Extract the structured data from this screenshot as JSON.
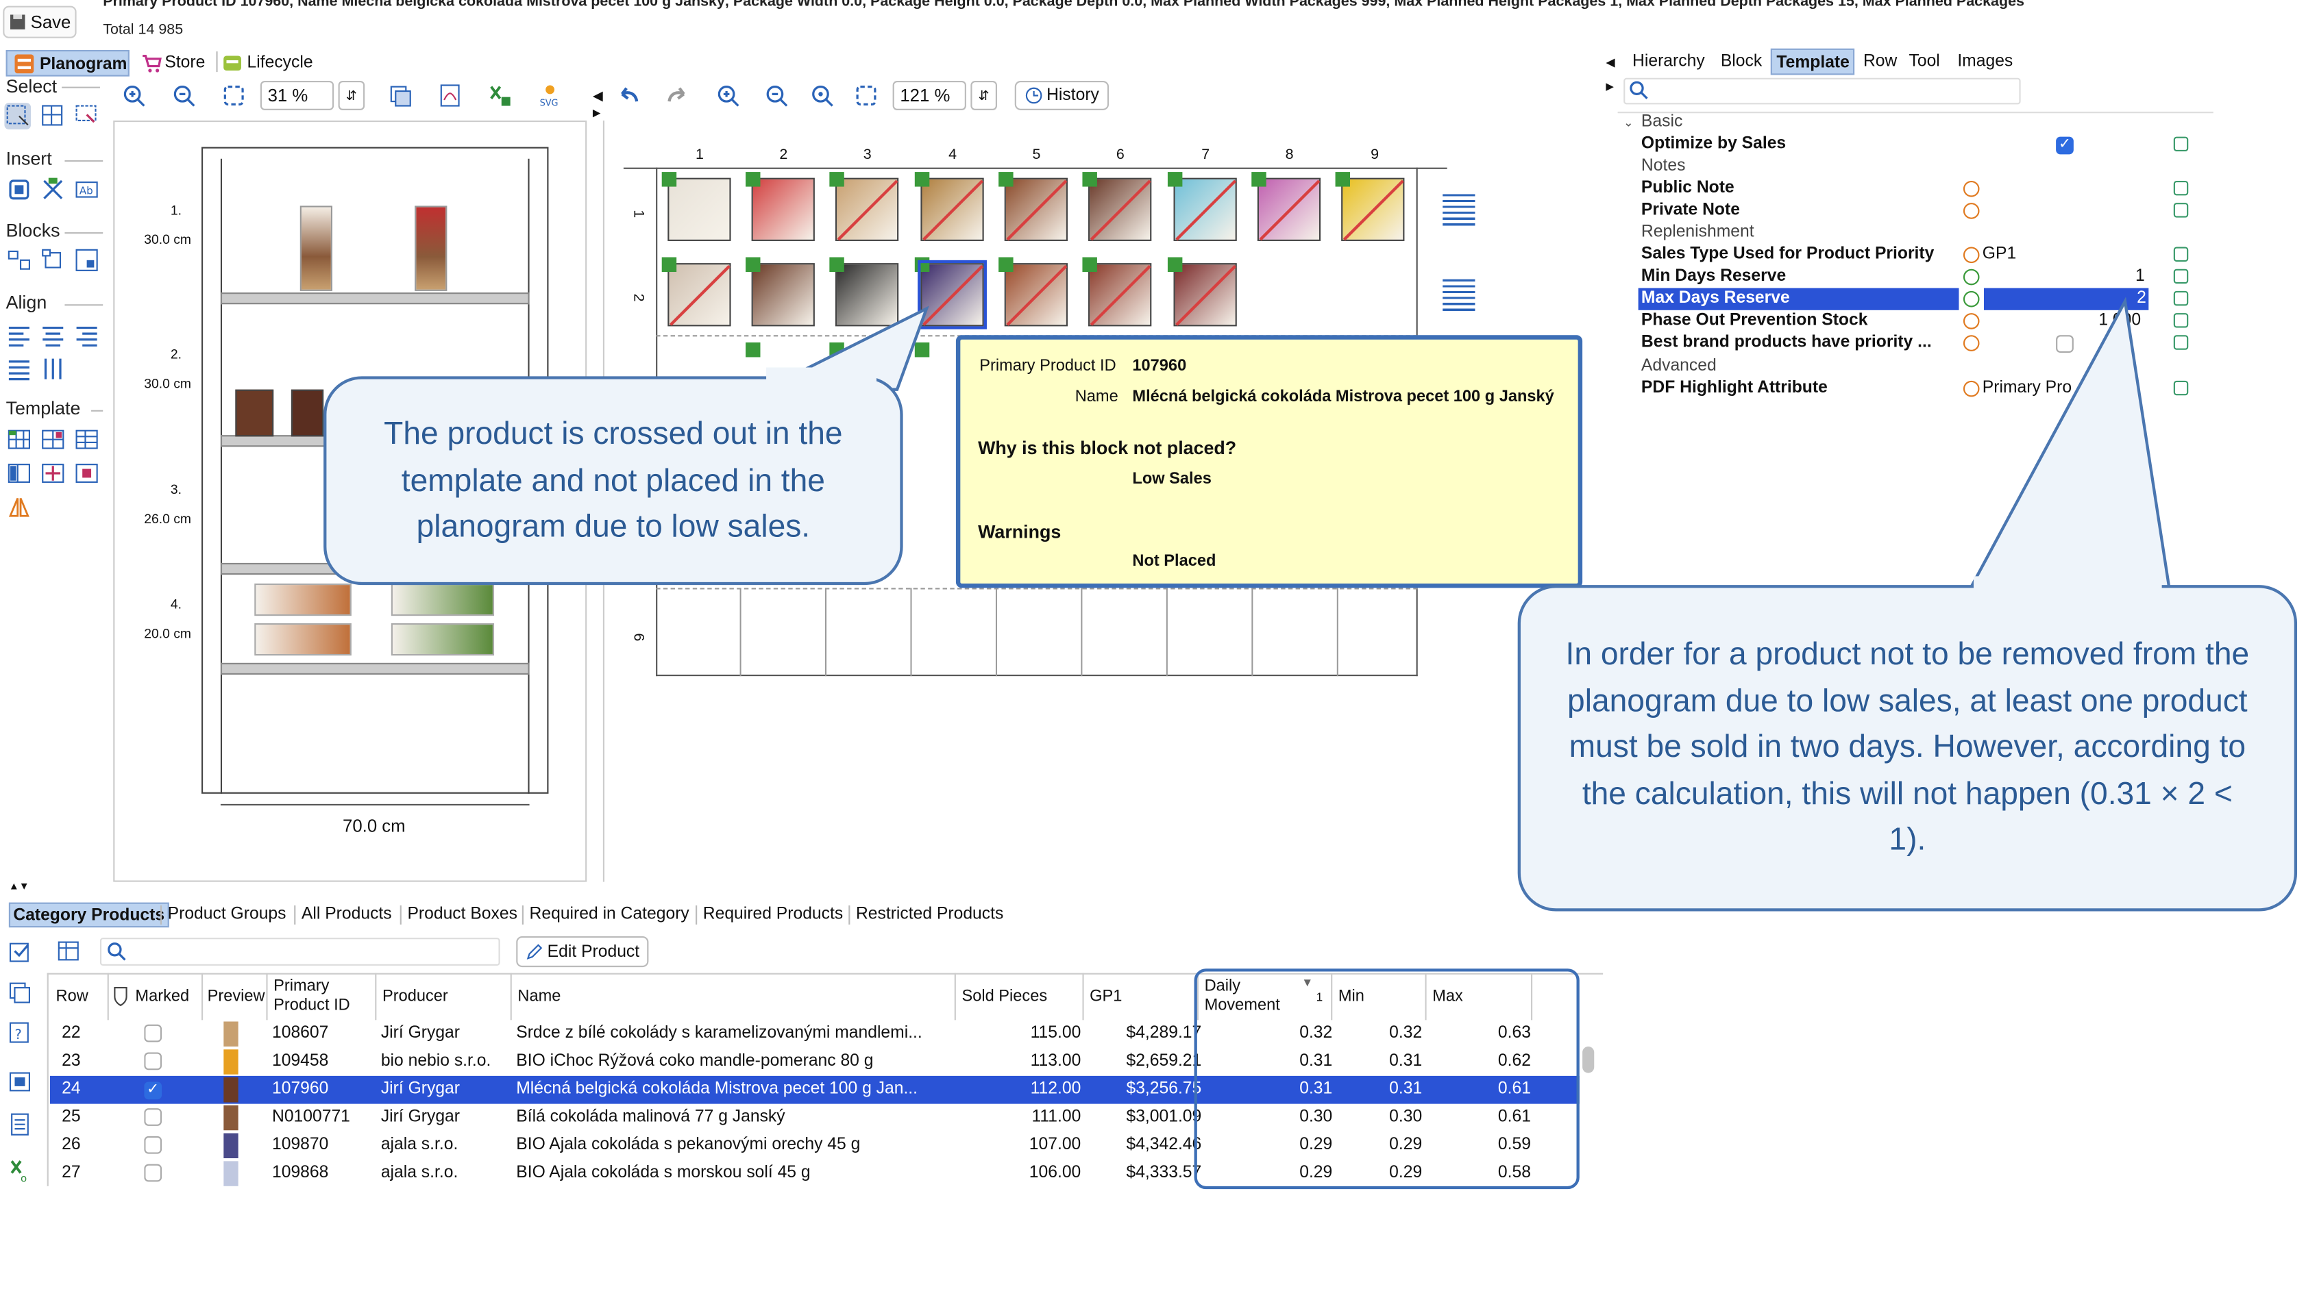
{
  "topbar": {
    "save_label": "Save",
    "info_line1": "Primary Product ID 107960, Name Mlécná belgická cokoláda Mistrova pecet 100 g Janský, Package Width 0.0, Package Height 0.0, Package Depth 0.0, Max Planned Width Packages 999, Max Planned Height Packages 1, Max Planned Depth Packages 15, Max Planned Packages",
    "info_line2": "Total 14 985"
  },
  "main_tabs": [
    "Planogram",
    "Store",
    "Lifecycle"
  ],
  "left_toolbar": {
    "zoom_left": "31 %",
    "zoom_right": "121 %",
    "history_label": "History"
  },
  "side_sections": [
    "Select",
    "Insert",
    "Blocks",
    "Align",
    "Template"
  ],
  "shelf_view": {
    "shelves": [
      {
        "num": "1.",
        "height": "30.0 cm"
      },
      {
        "num": "2.",
        "height": "30.0 cm"
      },
      {
        "num": "3.",
        "height": "26.0 cm"
      },
      {
        "num": "4.",
        "height": "20.0 cm"
      }
    ],
    "width_label": "70.0 cm"
  },
  "template_grid": {
    "columns": [
      "1",
      "2",
      "3",
      "4",
      "5",
      "6",
      "7",
      "8",
      "9"
    ],
    "rows": [
      "1",
      "2",
      "6"
    ]
  },
  "tooltip": {
    "pid_label": "Primary Product ID",
    "pid_value": "107960",
    "name_label": "Name",
    "name_value": "Mlécná belgická cokoláda Mistrova pecet 100 g Janský",
    "why_heading": "Why is this block not placed?",
    "why_value": "Low Sales",
    "warn_heading": "Warnings",
    "warn_value": "Not Placed"
  },
  "callouts": {
    "left": "The product is crossed out in the template and not placed in the planogram due to low sales.",
    "right": "In order for a product not to be removed from the planogram due to low sales, at least one product must be sold in two days. However, according to the calculation, this will not happen (0.31 × 2 < 1)."
  },
  "right_tabs": [
    "Hierarchy",
    "Block",
    "Template",
    "Row",
    "Tool",
    "Images"
  ],
  "properties": {
    "groups": {
      "basic": "Basic",
      "notes": "Notes",
      "replenishment": "Replenishment",
      "advanced": "Advanced"
    },
    "optimize_by_sales": "Optimize by Sales",
    "public_note": "Public Note",
    "private_note": "Private Note",
    "sales_type": "Sales Type Used for Product Priority",
    "sales_type_value": "GP1",
    "min_days": "Min Days Reserve",
    "min_days_value": "1",
    "max_days": "Max Days Reserve",
    "max_days_value": "2",
    "phase_out": "Phase Out Prevention Stock",
    "phase_out_value": "1 000",
    "best_brand": "Best brand products have priority ...",
    "pdf_highlight": "PDF Highlight Attribute",
    "pdf_highlight_value": "Primary Pro"
  },
  "bottom_tabs": [
    "Category Products",
    "Product Groups",
    "All Products",
    "Product Boxes",
    "Required in Category",
    "Required Products",
    "Restricted Products"
  ],
  "edit_product_label": "Edit Product",
  "table": {
    "headers": {
      "row": "Row",
      "marked": "Marked",
      "preview": "Preview",
      "pid1": "Primary",
      "pid2": "Product ID",
      "producer": "Producer",
      "name": "Name",
      "sold": "Sold Pieces",
      "gp1": "GP1",
      "daily1": "Daily",
      "daily2": "Movement",
      "sort_mark": "1",
      "min": "Min",
      "max": "Max"
    },
    "rows": [
      {
        "row": "22",
        "marked": false,
        "pid": "108607",
        "producer": "Jirí Grygar",
        "name": "Srdce z bílé cokolády s karamelizovanými mandlemi...",
        "sold": "115.00",
        "gp1": "$4,289.17",
        "daily": "0.32",
        "min": "0.32",
        "max": "0.63"
      },
      {
        "row": "23",
        "marked": false,
        "pid": "109458",
        "producer": "bio nebio s.r.o.",
        "name": "BIO iChoc Rýžová coko mandle-pomeranc 80 g",
        "sold": "113.00",
        "gp1": "$2,659.21",
        "daily": "0.31",
        "min": "0.31",
        "max": "0.62"
      },
      {
        "row": "24",
        "marked": true,
        "pid": "107960",
        "producer": "Jirí Grygar",
        "name": "Mlécná belgická cokoláda Mistrova pecet 100 g Jan...",
        "sold": "112.00",
        "gp1": "$3,256.75",
        "daily": "0.31",
        "min": "0.31",
        "max": "0.61"
      },
      {
        "row": "25",
        "marked": false,
        "pid": "N0100771",
        "producer": "Jirí Grygar",
        "name": "Bílá cokoláda malinová 77 g Janský",
        "sold": "111.00",
        "gp1": "$3,001.09",
        "daily": "0.30",
        "min": "0.30",
        "max": "0.61"
      },
      {
        "row": "26",
        "marked": false,
        "pid": "109870",
        "producer": "ajala s.r.o.",
        "name": "BIO Ajala cokoláda s pekanovými orechy 45 g",
        "sold": "107.00",
        "gp1": "$4,342.46",
        "daily": "0.29",
        "min": "0.29",
        "max": "0.59"
      },
      {
        "row": "27",
        "marked": false,
        "pid": "109868",
        "producer": "ajala s.r.o.",
        "name": "BIO Ajala cokoláda s morskou solí 45 g",
        "sold": "106.00",
        "gp1": "$4,333.57",
        "daily": "0.29",
        "min": "0.29",
        "max": "0.58"
      }
    ]
  }
}
